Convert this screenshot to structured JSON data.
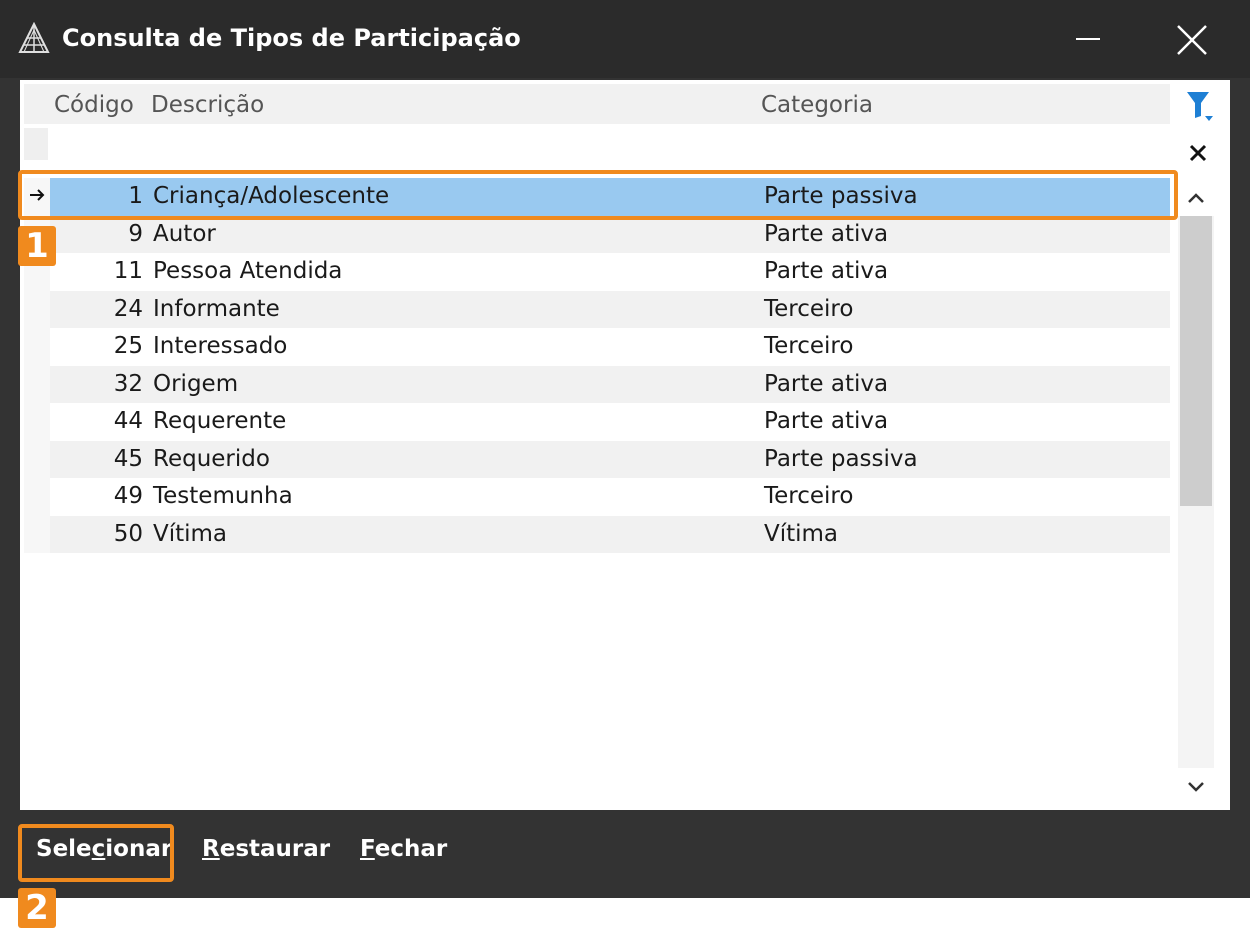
{
  "window": {
    "title": "Consulta de Tipos de Participação",
    "icons": {
      "app": "app-logo-icon",
      "minimize": "minimize-icon",
      "close": "close-icon"
    }
  },
  "grid": {
    "columns": {
      "codigo": "Código",
      "descricao": "Descrição",
      "categoria": "Categoria"
    },
    "filter_value": "",
    "selected_row": 0,
    "rows": [
      {
        "codigo": "1",
        "descricao": "Criança/Adolescente",
        "categoria": "Parte passiva"
      },
      {
        "codigo": "9",
        "descricao": "Autor",
        "categoria": "Parte ativa"
      },
      {
        "codigo": "11",
        "descricao": "Pessoa Atendida",
        "categoria": "Parte ativa"
      },
      {
        "codigo": "24",
        "descricao": "Informante",
        "categoria": "Terceiro"
      },
      {
        "codigo": "25",
        "descricao": "Interessado",
        "categoria": "Terceiro"
      },
      {
        "codigo": "32",
        "descricao": "Origem",
        "categoria": "Parte ativa"
      },
      {
        "codigo": "44",
        "descricao": "Requerente",
        "categoria": "Parte ativa"
      },
      {
        "codigo": "45",
        "descricao": "Requerido",
        "categoria": "Parte passiva"
      },
      {
        "codigo": "49",
        "descricao": "Testemunha",
        "categoria": "Terceiro"
      },
      {
        "codigo": "50",
        "descricao": "Vítima",
        "categoria": "Vítima"
      }
    ]
  },
  "side_tools": {
    "filter_icon": "filter-dropdown-icon",
    "clear_icon": "clear-filter-icon"
  },
  "footer": {
    "selecionar": {
      "before": "Sele",
      "mnemonic": "c",
      "after": "ionar"
    },
    "restaurar": {
      "before": "",
      "mnemonic": "R",
      "after": "estaurar"
    },
    "fechar": {
      "before": "",
      "mnemonic": "F",
      "after": "echar"
    }
  },
  "annotations": {
    "badge_1": "1",
    "badge_2": "2",
    "accent_color": "#f08a1e"
  },
  "colors": {
    "titlebar": "#2b2b2b",
    "selected_row": "#99c9f0",
    "alt_row": "#f1f1f1",
    "filter_icon": "#1e7fd4"
  }
}
